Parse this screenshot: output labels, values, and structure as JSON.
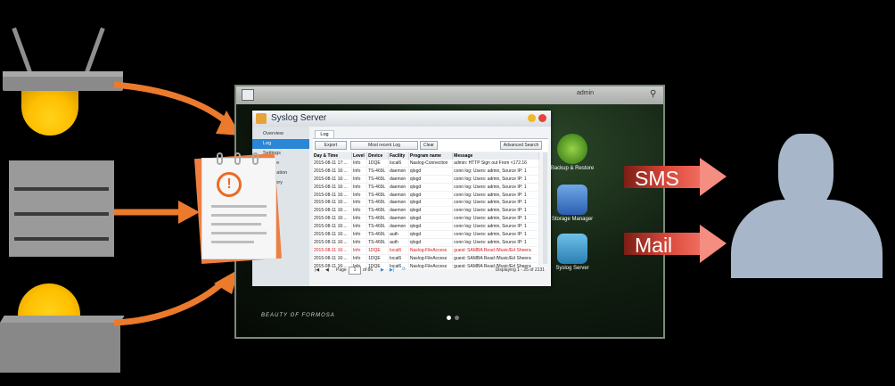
{
  "taskbar": {
    "user": "admin"
  },
  "window": {
    "title": "Syslog Server",
    "sidebar": [
      "Overview",
      "Log",
      "Settings",
      "Archive",
      "Notification",
      "Directory"
    ],
    "tab": "Log",
    "toolbar": {
      "export": "Export",
      "filter": "Most recent Log",
      "clear": "Clear",
      "advanced": "Advanced Search"
    },
    "columns": [
      "Day & Time",
      "Level",
      "Device",
      "Facility",
      "Program name",
      "Message"
    ],
    "rows": [
      [
        "2015-08-11 17:...",
        "Info",
        "1DQE",
        "local6",
        "Naslog-Connection",
        "admin: HTTP Sign out From <172.16"
      ],
      [
        "2015-08-11 16:...",
        "Info",
        "TS-469L",
        "daemon",
        "qlogd",
        "conn log: Users: admin, Source IP: 1"
      ],
      [
        "2015-08-11 16:...",
        "Info",
        "TS-469L",
        "daemon",
        "qlogd",
        "conn log: Users: admin, Source IP: 1"
      ],
      [
        "2015-08-11 16:...",
        "Info",
        "TS-469L",
        "daemon",
        "qlogd",
        "conn log: Users: admin, Source IP: 1"
      ],
      [
        "2015-08-11 16:...",
        "Info",
        "TS-469L",
        "daemon",
        "qlogd",
        "conn log: Users: admin, Source IP: 1"
      ],
      [
        "2015-08-11 16:...",
        "Info",
        "TS-469L",
        "daemon",
        "qlogd",
        "conn log: Users: admin, Source IP: 1"
      ],
      [
        "2015-08-11 16:...",
        "Info",
        "TS-469L",
        "daemon",
        "qlogd",
        "conn log: Users: admin, Source IP: 1"
      ],
      [
        "2015-08-11 16:...",
        "Info",
        "TS-469L",
        "daemon",
        "qlogd",
        "conn log: Users: admin, Source IP: 1"
      ],
      [
        "2015-08-11 16:...",
        "Info",
        "TS-469L",
        "daemon",
        "qlogd",
        "conn log: Users: admin, Source IP: 1"
      ],
      [
        "2015-08-11 16:...",
        "Info",
        "TS-469L",
        "auth",
        "qlogd",
        "conn log: Users: admin, Source IP: 1"
      ],
      [
        "2015-08-11 16:...",
        "Info",
        "TS-469L",
        "auth",
        "qlogd",
        "conn log: Users: admin, Source IP: 1"
      ],
      [
        "2015-08-11 16:...",
        "Info",
        "1DQE",
        "local6",
        "Naslog-FileAccess",
        "guest: SAMBA Read /Music/Ed Sheera"
      ],
      [
        "2015-08-11 16:...",
        "Info",
        "1DQE",
        "local6",
        "Naslog-FileAccess",
        "guest: SAMBA Read /Music/Ed Sheera"
      ],
      [
        "2015-08-11 16:...",
        "Info",
        "1DQE",
        "local6",
        "Naslog-FileAccess",
        "guest: SAMBA Read /Music/Ed Sheera"
      ]
    ],
    "error_rows": [
      11
    ],
    "pager": {
      "page_label": "Page",
      "page_value": "1",
      "of_label": "of 86",
      "display": "Displaying 1 - 25 of 2131"
    }
  },
  "desktop_icons": [
    "Backup & Restore",
    "Storage Manager",
    "Syslog Server"
  ],
  "wallpaper_text": "BEAUTY OF FORMOSA",
  "arrows": {
    "sms": "SMS",
    "mail": "Mail"
  },
  "colors": {
    "accent": "#2b86d6",
    "error": "#d41a1a",
    "orange": "#ec7a2c",
    "bulb": "#ffc400",
    "person": "#a7b6c8"
  }
}
